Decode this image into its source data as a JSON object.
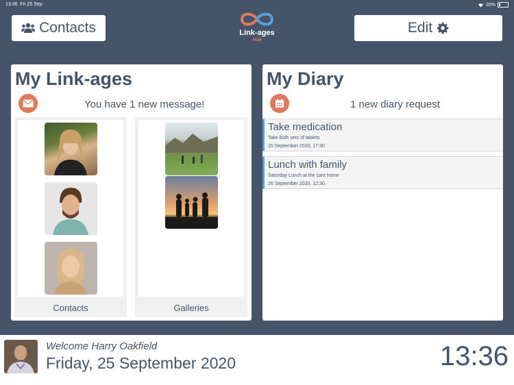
{
  "status_bar": {
    "time": "13:36",
    "date": "Fri 25 Sep",
    "battery": "20%"
  },
  "header": {
    "contacts_label": "Contacts",
    "edit_label": "Edit",
    "logo_name": "Link-ages",
    "logo_sub": "Hub"
  },
  "links_panel": {
    "title": "My Link-ages",
    "message": "You have 1 new message!",
    "contacts_label": "Contacts",
    "galleries_label": "Galleries"
  },
  "diary_panel": {
    "title": "My Diary",
    "notice": "1 new diary request",
    "items": [
      {
        "title": "Take medication",
        "description": "Take both sets of tablets",
        "when": "25 September 2020, 17:30"
      },
      {
        "title": "Lunch with family",
        "description": "Saturday Lunch at the care home",
        "when": "26 September 2020, 12:30"
      }
    ]
  },
  "footer": {
    "welcome": "Welcome Harry Oakfield",
    "date": "Friday, 25 September 2020",
    "clock": "13:36"
  },
  "colors": {
    "background": "#46546a",
    "accent": "#e07a5f",
    "diary_bar": "#5aa0d8"
  }
}
